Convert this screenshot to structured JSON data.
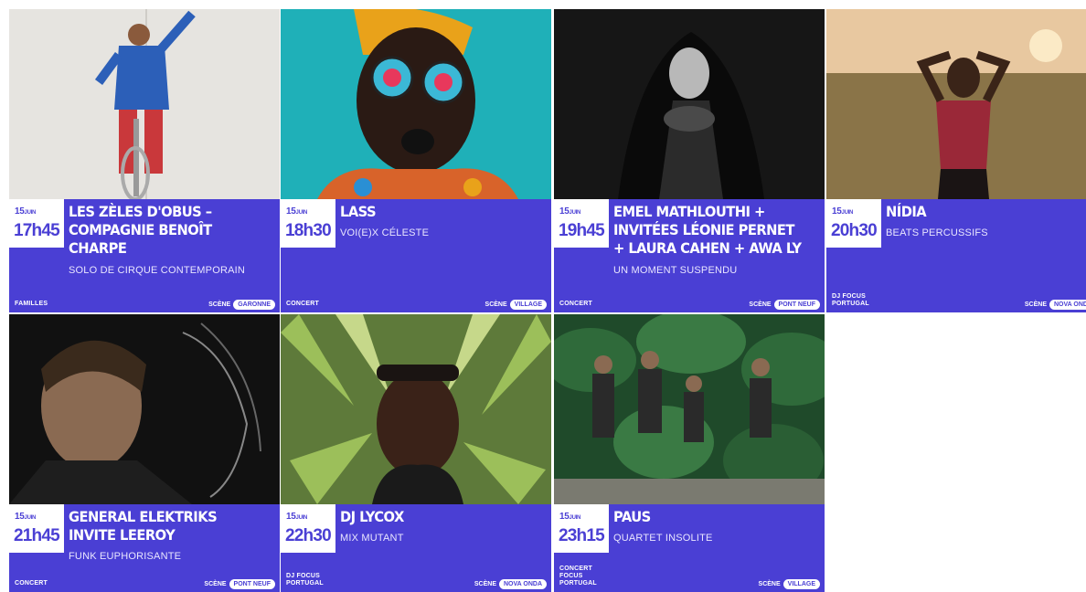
{
  "events": [
    {
      "day": "15",
      "month": "JUIN",
      "time": "17h45",
      "title": "LES ZÈLES D'OBUS – COMPAGNIE BENOÎT CHARPE",
      "subtitle": "SOLO DE CIRQUE CONTEMPORAIN",
      "category": [
        "FAMILLES"
      ],
      "scene_label": "SCÈNE",
      "scene": "GARONNE"
    },
    {
      "day": "15",
      "month": "JUIN",
      "time": "18h30",
      "title": "LASS",
      "subtitle": "VOI(E)X CÉLESTE",
      "category": [
        "CONCERT"
      ],
      "scene_label": "SCÈNE",
      "scene": "VILLAGE"
    },
    {
      "day": "15",
      "month": "JUIN",
      "time": "19h45",
      "title": "EMEL MATHLOUTHI + INVITÉES LÉONIE PERNET + LAURA CAHEN + AWA LY",
      "subtitle": "UN MOMENT SUSPENDU",
      "category": [
        "CONCERT"
      ],
      "scene_label": "SCÈNE",
      "scene": "PONT NEUF"
    },
    {
      "day": "15",
      "month": "JUIN",
      "time": "20h30",
      "title": "NÍDIA",
      "subtitle": "BEATS PERCUSSIFS",
      "category": [
        "DJ FOCUS",
        "PORTUGAL"
      ],
      "scene_label": "SCÈNE",
      "scene": "NOVA ONDA"
    },
    {
      "day": "15",
      "month": "JUIN",
      "time": "21h45",
      "title": "GENERAL ELEKTRIKS INVITE LEEROY",
      "subtitle": "FUNK EUPHORISANTE",
      "category": [
        "CONCERT"
      ],
      "scene_label": "SCÈNE",
      "scene": "PONT NEUF"
    },
    {
      "day": "15",
      "month": "JUIN",
      "time": "22h30",
      "title": "DJ LYCOX",
      "subtitle": "MIX MUTANT",
      "category": [
        "DJ FOCUS",
        "PORTUGAL"
      ],
      "scene_label": "SCÈNE",
      "scene": "NOVA ONDA"
    },
    {
      "day": "15",
      "month": "JUIN",
      "time": "23h15",
      "title": "PAUS",
      "subtitle": "QUARTET INSOLITE",
      "category": [
        "CONCERT",
        "FOCUS",
        "PORTUGAL"
      ],
      "scene_label": "SCÈNE",
      "scene": "VILLAGE"
    }
  ],
  "colors": {
    "accent": "#4a3fd4",
    "pill_bg": "#ffffff"
  }
}
